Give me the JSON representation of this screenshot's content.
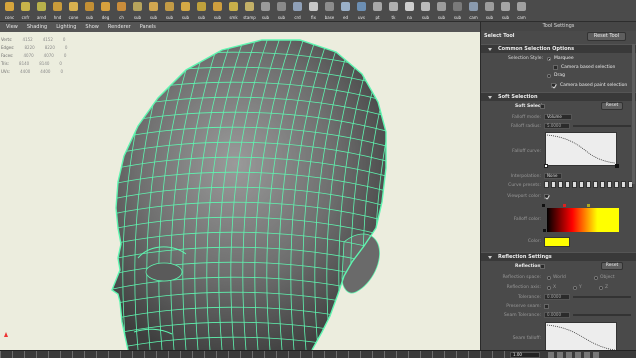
{
  "shelf": {
    "tools": [
      {
        "label": "conc",
        "color": "#d7a53c"
      },
      {
        "label": "cnfr",
        "color": "#c9b44a"
      },
      {
        "label": "arnd",
        "color": "#b8b14b"
      },
      {
        "label": "hnd",
        "color": "#c99b3a"
      },
      {
        "label": "cone",
        "color": "#d9b24f"
      },
      {
        "label": "sub",
        "color": "#c38f34"
      },
      {
        "label": "deg",
        "color": "#d8a13d"
      },
      {
        "label": "ch",
        "color": "#c98c3b"
      },
      {
        "label": "sub",
        "color": "#b7a45c"
      },
      {
        "label": "sub",
        "color": "#d1a750"
      },
      {
        "label": "sub",
        "color": "#c39b45"
      },
      {
        "label": "sub",
        "color": "#d4a945"
      },
      {
        "label": "sub",
        "color": "#bfa13c"
      },
      {
        "label": "sub",
        "color": "#cf9f3e"
      },
      {
        "label": "smk",
        "color": "#c9b04a"
      },
      {
        "label": "stamp",
        "color": "#c3b067"
      },
      {
        "label": "sub",
        "color": "#9a9a9a"
      },
      {
        "label": "sub",
        "color": "#8a8a8a"
      },
      {
        "label": "crd",
        "color": "#8fa0b8"
      },
      {
        "label": "fix",
        "color": "#c7c7c7"
      },
      {
        "label": "base",
        "color": "#8d8d8d"
      },
      {
        "label": "ed",
        "color": "#9ab0c8"
      },
      {
        "label": "uvs",
        "color": "#6c8fb4"
      },
      {
        "label": "pt",
        "color": "#a8a8a8"
      },
      {
        "label": "tk",
        "color": "#b0b0b0"
      },
      {
        "label": "na",
        "color": "#cfcfcf"
      },
      {
        "label": "sub",
        "color": "#bcbcbc"
      },
      {
        "label": "sub",
        "color": "#9c9c9c"
      },
      {
        "label": "sub",
        "color": "#7a7a7a"
      },
      {
        "label": "cam",
        "color": "#8a9aae"
      },
      {
        "label": "sub",
        "color": "#9d9d9d"
      },
      {
        "label": "sub",
        "color": "#a6a6a6"
      },
      {
        "label": "cam",
        "color": "#a0a0a0"
      }
    ]
  },
  "panel_menu": [
    "View",
    "Shading",
    "Lighting",
    "Show",
    "Renderer",
    "Panels"
  ],
  "hud": {
    "rows": [
      {
        "label": "Verts:",
        "values": [
          "4152",
          "4152",
          "0"
        ]
      },
      {
        "label": "Edges:",
        "values": [
          "8220",
          "8220",
          "0"
        ]
      },
      {
        "label": "Faces:",
        "values": [
          "4070",
          "4070",
          "0"
        ]
      },
      {
        "label": "Tris:",
        "values": [
          "8140",
          "8140",
          "0"
        ]
      },
      {
        "label": "UVs:",
        "values": [
          "4400",
          "4400",
          "0"
        ]
      }
    ]
  },
  "tool_settings": {
    "title": "Tool Settings",
    "tool_name": "Select Tool",
    "reset_tool": "Reset Tool",
    "common": {
      "header": "Common Selection Options",
      "selection_style_label": "Selection Style:",
      "marquee": "Marquee",
      "camera_based_selection": "Camera based selection",
      "drag": "Drag",
      "camera_based_paint_selection": "Camera based paint selection"
    },
    "soft": {
      "header": "Soft Selection",
      "soft_select": "Soft Select",
      "reset": "Reset",
      "falloff_mode_label": "Falloff mode:",
      "falloff_mode_value": "Volume",
      "falloff_radius_label": "Falloff radius:",
      "falloff_radius_value": "5.0000",
      "falloff_curve_label": "Falloff curve:",
      "interpolation_label": "Interpolation:",
      "interpolation_value": "None",
      "curve_presets_label": "Curve presets:",
      "viewport_color_label": "Viewport color:",
      "falloff_color_label": "Falloff color:",
      "color_label": "Color:",
      "color_swatch": "#ffff00",
      "gradient_colors": [
        "#ff0000",
        "#ffff00"
      ]
    },
    "reflection": {
      "header": "Reflection Settings",
      "reflection": "Reflection",
      "reset": "Reset",
      "reflection_space_label": "Reflection space:",
      "world": "World",
      "object": "Object",
      "reflection_axis_label": "Reflection axis:",
      "axes": [
        "X",
        "Y",
        "Z"
      ],
      "tolerance_label": "Tolerance:",
      "tolerance_value": "0.0000",
      "preserve_seam_label": "Preserve seam:",
      "seam_tolerance_label": "Seam Tolerance:",
      "seam_tolerance_value": "0.0000",
      "seam_falloff_label": "Seam falloff:"
    }
  },
  "timeline": {
    "current_frame": "1.00"
  },
  "colors": {
    "viewport_bg": "#ecedde",
    "wire": "#5ff5b0",
    "panel_bg": "#4a4a4a",
    "section_bg": "#393939"
  }
}
